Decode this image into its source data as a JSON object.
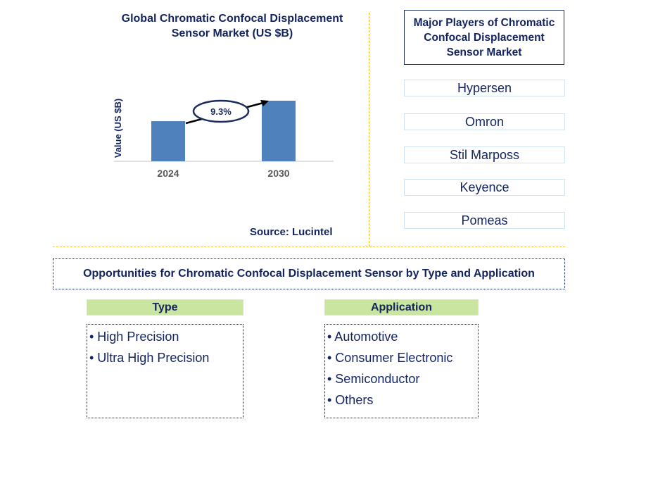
{
  "chart_data": {
    "type": "bar",
    "title": "Global Chromatic Confocal Displacement Sensor Market (US $B)",
    "xlabel": "",
    "ylabel": "Value (US $B)",
    "categories": [
      "2024",
      "2030"
    ],
    "values": [
      1.0,
      1.51
    ],
    "values_note": "relative heights estimated; no value labels shown",
    "annotation": {
      "label": "9.3%",
      "meaning": "CAGR arrow from 2024 to 2030"
    },
    "bar_color": "#4f81bd",
    "grid": false,
    "source": "Source: Lucintel"
  },
  "players": {
    "title": "Major Players of Chromatic Confocal Displacement Sensor Market",
    "items": [
      "Hypersen",
      "Omron",
      "Stil Marposs",
      "Keyence",
      "Pomeas"
    ]
  },
  "opportunities": {
    "title": "Opportunities for Chromatic Confocal Displacement Sensor by Type and Application",
    "type": {
      "heading": "Type",
      "items": [
        "• High Precision",
        "• Ultra High Precision"
      ]
    },
    "application": {
      "heading": "Application",
      "items": [
        "• Automotive",
        "• Consumer Electronic",
        "• Semiconductor",
        "• Others"
      ]
    }
  },
  "colors": {
    "text": "#13235f",
    "bar": "#4f81bd",
    "divider": "#f5b800",
    "category_header": "#c9e5a0",
    "player_border": "#cfe3f2"
  }
}
